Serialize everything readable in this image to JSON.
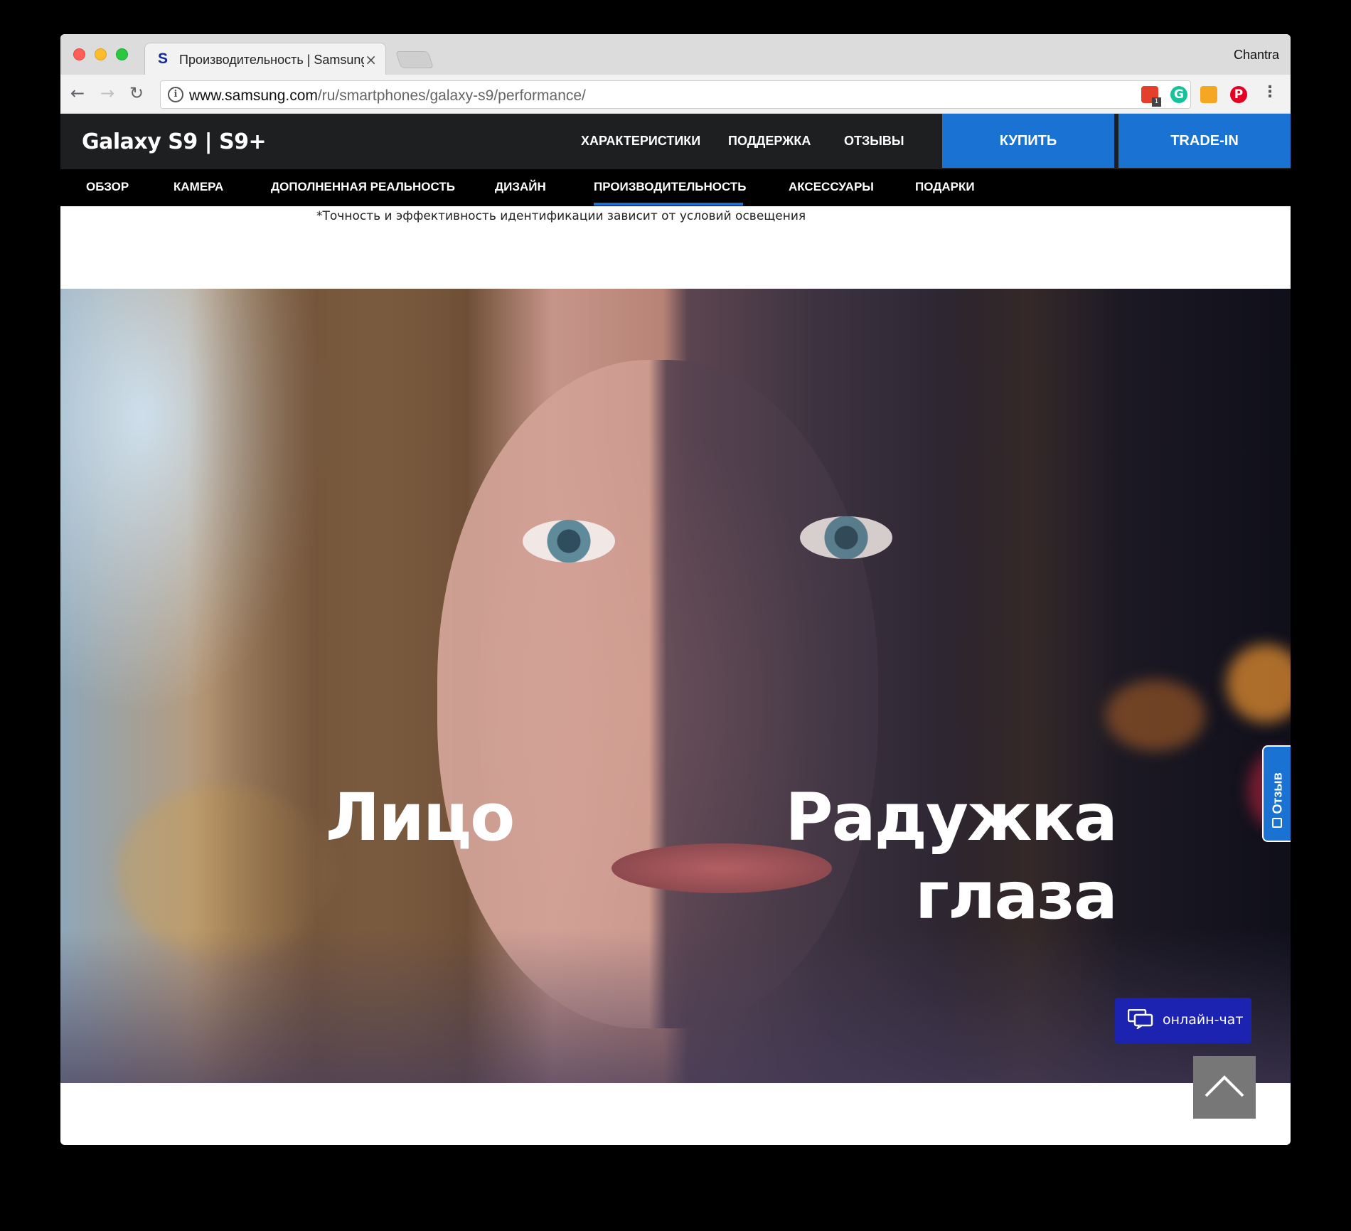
{
  "browser": {
    "tab_title": "Производительность | Samsung",
    "tab_favicon": "S",
    "tab_close": "×",
    "profile_name": "Chantra",
    "url_host": "www.samsung.com",
    "url_path": "/ru/smartphones/galaxy-s9/performance/",
    "info_icon": "i",
    "calendar_badge": "1",
    "grammarly_letter": "G",
    "pinterest_letter": "P"
  },
  "site": {
    "brand": "Galaxy S9 | S9+",
    "top_nav": [
      {
        "label": "ХАРАКТЕРИСТИКИ"
      },
      {
        "label": "ПОДДЕРЖКА"
      },
      {
        "label": "ОТЗЫВЫ"
      }
    ],
    "buy_label": "КУПИТЬ",
    "tradein_label": "TRADE-IN",
    "sub_nav": [
      {
        "label": "ОБЗОР"
      },
      {
        "label": "КАМЕРА"
      },
      {
        "label": "ДОПОЛНЕННАЯ РЕАЛЬНОСТЬ"
      },
      {
        "label": "ДИЗАЙН"
      },
      {
        "label": "ПРОИЗВОДИТЕЛЬНОСТЬ"
      },
      {
        "label": "АКСЕССУАРЫ"
      },
      {
        "label": "ПОДАРКИ"
      }
    ],
    "active_sub_nav": "ПРОИЗВОДИТЕЛЬНОСТЬ",
    "footnote": "*Точность и эффективность идентификации зависит от условий освещения",
    "hero": {
      "left_title": "Лицо",
      "right_title_line1": "Радужка",
      "right_title_line2": "глаза"
    },
    "feedback_label": "Отзыв",
    "chat_label": "онлайн-чат"
  },
  "colors": {
    "accent_blue": "#1a73d2",
    "chat_blue": "#1b23b0",
    "header_bg": "#1e1f21"
  },
  "icons": [
    "back-arrow-icon",
    "forward-arrow-icon",
    "reload-icon",
    "info-icon",
    "bookmark-star-icon",
    "calendar-extension-icon",
    "grammarly-extension-icon",
    "chart-extension-icon",
    "pinterest-extension-icon",
    "menu-dots-icon",
    "chat-bubbles-icon",
    "chevron-up-icon"
  ]
}
